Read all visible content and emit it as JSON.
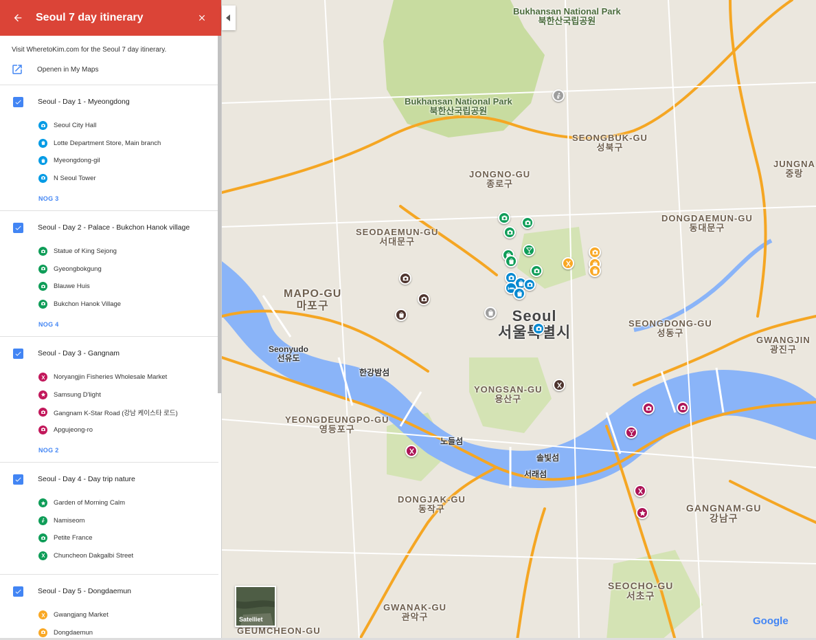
{
  "header": {
    "title": "Seoul 7 day itinerary",
    "accent": "#db4437"
  },
  "intro": {
    "description": "Visit WheretoKim.com for the Seoul 7 day itinerary.",
    "open_label": "Openen in My Maps"
  },
  "layers": [
    {
      "title": "Seoul - Day 1 - Myeongdong",
      "color": "#039be5",
      "items": [
        {
          "label": "Seoul City Hall",
          "icon": "camera-icon"
        },
        {
          "label": "Lotte Department Store, Main branch",
          "icon": "shopping-bag-icon"
        },
        {
          "label": "Myeongdong-gil",
          "icon": "shopping-bag-icon"
        },
        {
          "label": "N Seoul Tower",
          "icon": "camera-icon"
        }
      ],
      "more_label": "NOG 3"
    },
    {
      "title": "Seoul - Day 2 - Palace - Bukchon Hanok village",
      "color": "#0f9d58",
      "items": [
        {
          "label": "Statue of King Sejong",
          "icon": "camera-icon"
        },
        {
          "label": "Gyeongbokgung",
          "icon": "camera-icon"
        },
        {
          "label": "Blauwe Huis",
          "icon": "camera-icon"
        },
        {
          "label": "Bukchon Hanok Village",
          "icon": "camera-icon"
        }
      ],
      "more_label": "NOG 4"
    },
    {
      "title": "Seoul - Day 3 - Gangnam",
      "color": "#c2185b",
      "items": [
        {
          "label": "Noryangjin Fisheries Wholesale Market",
          "icon": "restaurant-icon"
        },
        {
          "label": "Samsung D'light",
          "icon": "star-icon"
        },
        {
          "label": "Gangnam K-Star Road (강남 케이스타 로드)",
          "icon": "camera-icon"
        },
        {
          "label": "Apgujeong-ro",
          "icon": "camera-icon"
        }
      ],
      "more_label": "NOG 2"
    },
    {
      "title": "Seoul - Day 4 - Day trip nature",
      "color": "#0f9d58",
      "items": [
        {
          "label": "Garden of Morning Calm",
          "icon": "star-icon"
        },
        {
          "label": "Namiseom",
          "icon": "hiking-icon"
        },
        {
          "label": "Petite France",
          "icon": "camera-icon"
        },
        {
          "label": "Chuncheon Dakgalbi Street",
          "icon": "restaurant-icon"
        }
      ],
      "more_label": ""
    },
    {
      "title": "Seoul - Day 5 - Dongdaemun",
      "color": "#f9a825",
      "items": [
        {
          "label": "Gwangjang Market",
          "icon": "restaurant-icon"
        },
        {
          "label": "Dongdaemun",
          "icon": "camera-icon"
        }
      ],
      "more_label": ""
    }
  ],
  "map": {
    "labels": {
      "bukhansan_top_en": "Bukhansan National Park",
      "bukhansan_top_ko": "북한산국립공원",
      "bukhansan_mid_en": "Bukhansan National Park",
      "bukhansan_mid_ko": "북한산국립공원",
      "seongbuk_en": "SEONGBUK-GU",
      "seongbuk_ko": "성북구",
      "jongno_en": "JONGNO-GU",
      "jongno_ko": "종로구",
      "jungnang_en": "JUNGNA",
      "jungnang_ko": "중랑",
      "seodaemun_en": "SEODAEMUN-GU",
      "seodaemun_ko": "서대문구",
      "dongdaemun_en": "DONGDAEMUN-GU",
      "dongdaemun_ko": "동대문구",
      "mapo_en": "MAPO-GU",
      "mapo_ko": "마포구",
      "seoul_en": "Seoul",
      "seoul_ko": "서울특별시",
      "seongdong_en": "SEONGDONG-GU",
      "seongdong_ko": "성동구",
      "gwangjin_en": "GWANGJIN",
      "gwangjin_ko": "광진구",
      "seonyudo_en": "Seonyudo",
      "seonyudo_ko": "선유도",
      "hangang_ko": "한강밤섬",
      "yongsan_en": "YONGSAN-GU",
      "yongsan_ko": "용산구",
      "yeongdeungpo_en": "YEONGDEUNGPO-GU",
      "yeongdeungpo_ko": "영등포구",
      "nodeul_ko": "노들섬",
      "sobit_ko": "솔빛섬",
      "seorae_ko": "서래섬",
      "dongjak_en": "DONGJAK-GU",
      "dongjak_ko": "동작구",
      "gangnam_en": "GANGNAM-GU",
      "gangnam_ko": "강남구",
      "seocho_en": "SEOCHO-GU",
      "seocho_ko": "서초구",
      "gwanak_en": "GWANAK-GU",
      "gwanak_ko": "관악구",
      "geumcheon_en": "GEUMCHEON-GU"
    },
    "satellite_label": "Satelliet",
    "google_logo": "Google",
    "colors": {
      "water": "#8ab4f8",
      "park": "#c8dca0",
      "road": "#f5a623",
      "blue_marker": "#0288d1",
      "green_marker": "#0f9d58",
      "magenta_marker": "#ad1457",
      "yellow_marker": "#f9a825",
      "brown_marker": "#4e342e",
      "gray_marker": "#9e9e9e"
    }
  }
}
